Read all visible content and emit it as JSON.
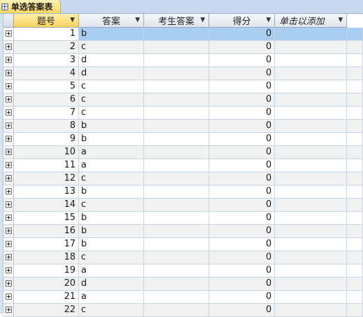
{
  "tab": {
    "label": "单选答案表"
  },
  "columns": [
    {
      "key": "id",
      "label": "题号"
    },
    {
      "key": "answer",
      "label": "答案"
    },
    {
      "key": "student_answer",
      "label": "考生答案"
    },
    {
      "key": "score",
      "label": "得分"
    },
    {
      "key": "add",
      "label": "单击以添加"
    }
  ],
  "rows": [
    {
      "id": "1",
      "answer": "b",
      "student_answer": "",
      "score": "0"
    },
    {
      "id": "2",
      "answer": "c",
      "student_answer": "",
      "score": "0"
    },
    {
      "id": "3",
      "answer": "d",
      "student_answer": "",
      "score": "0"
    },
    {
      "id": "4",
      "answer": "d",
      "student_answer": "",
      "score": "0"
    },
    {
      "id": "5",
      "answer": "c",
      "student_answer": "",
      "score": "0"
    },
    {
      "id": "6",
      "answer": "c",
      "student_answer": "",
      "score": "0"
    },
    {
      "id": "7",
      "answer": "c",
      "student_answer": "",
      "score": "0"
    },
    {
      "id": "8",
      "answer": "b",
      "student_answer": "",
      "score": "0"
    },
    {
      "id": "9",
      "answer": "b",
      "student_answer": "",
      "score": "0"
    },
    {
      "id": "10",
      "answer": "a",
      "student_answer": "",
      "score": "0"
    },
    {
      "id": "11",
      "answer": "a",
      "student_answer": "",
      "score": "0"
    },
    {
      "id": "12",
      "answer": "c",
      "student_answer": "",
      "score": "0"
    },
    {
      "id": "13",
      "answer": "b",
      "student_answer": "",
      "score": "0"
    },
    {
      "id": "14",
      "answer": "c",
      "student_answer": "",
      "score": "0"
    },
    {
      "id": "15",
      "answer": "b",
      "student_answer": "",
      "score": "0"
    },
    {
      "id": "16",
      "answer": "b",
      "student_answer": "",
      "score": "0"
    },
    {
      "id": "17",
      "answer": "b",
      "student_answer": "",
      "score": "0"
    },
    {
      "id": "18",
      "answer": "c",
      "student_answer": "",
      "score": "0"
    },
    {
      "id": "19",
      "answer": "a",
      "student_answer": "",
      "score": "0"
    },
    {
      "id": "20",
      "answer": "d",
      "student_answer": "",
      "score": "0"
    },
    {
      "id": "21",
      "answer": "a",
      "student_answer": "",
      "score": "0"
    },
    {
      "id": "22",
      "answer": "c",
      "student_answer": "",
      "score": "0"
    }
  ],
  "selection": {
    "active_row": 1,
    "sorted_column": "id"
  },
  "icons": {
    "tab": "table-icon",
    "row_expand": "expand-plus-icon",
    "column_menu": "dropdown-arrow-icon"
  },
  "colors": {
    "active_row": "#a9cdf0",
    "selected_header": "#ffd35a",
    "tab": "#ffd95e"
  }
}
